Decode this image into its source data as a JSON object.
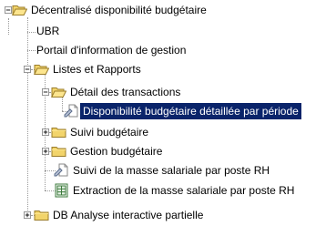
{
  "tree": {
    "root": {
      "label": "Décentralisé disponibilité budgétaire",
      "toggle": "minus",
      "icon": "folder-open-icon"
    },
    "items": [
      {
        "label": "UBR",
        "icon": "none"
      },
      {
        "label": "Portail d'information de gestion",
        "icon": "none"
      },
      {
        "label": "Listes et Rapports",
        "toggle": "minus",
        "icon": "folder-open-icon"
      },
      {
        "label": "Détail des transactions",
        "toggle": "minus",
        "icon": "folder-open-icon"
      },
      {
        "label": "Disponibilité budgétaire détaillée par période",
        "icon": "report-icon",
        "selected": true
      },
      {
        "label": "Suivi budgétaire",
        "toggle": "plus",
        "icon": "folder-closed-icon"
      },
      {
        "label": "Gestion budgétaire",
        "toggle": "plus",
        "icon": "folder-closed-icon"
      },
      {
        "label": "Suivi de la masse salariale par poste RH",
        "icon": "report-icon"
      },
      {
        "label": "Extraction de la masse salariale par poste RH",
        "icon": "spreadsheet-icon"
      },
      {
        "label": "DB Analyse interactive partielle",
        "toggle": "plus",
        "icon": "folder-closed-icon"
      }
    ]
  },
  "colors": {
    "selection": "#0a246a",
    "folder": "#f2d46b",
    "folder_border": "#9b7d2a",
    "connector": "#9a9a9a"
  }
}
